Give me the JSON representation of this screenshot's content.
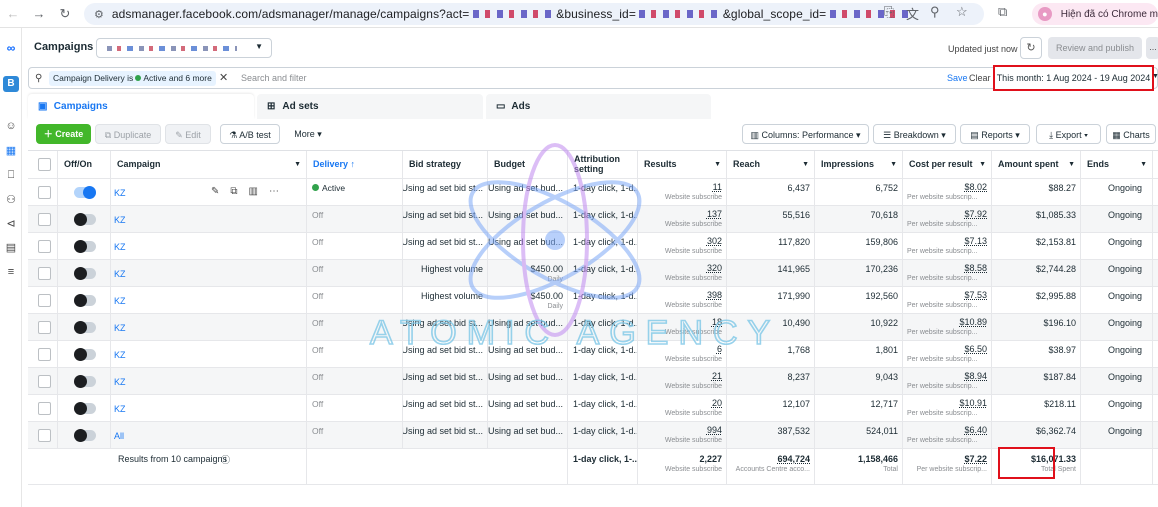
{
  "browser": {
    "url_host": "adsmanager.facebook.com",
    "url_path": "/adsmanager/manage/campaigns?act=",
    "url_param_business": "&business_id=",
    "url_param_scope": "&global_scope_id=",
    "profile_label": "Hiện đã có Chrome m"
  },
  "rail": {
    "badge_letter": "B",
    "help_label": "?"
  },
  "header": {
    "title": "Campaigns",
    "updated_text": "Updated just now",
    "review_label": "Review and publish",
    "more_label": "..."
  },
  "filter": {
    "chip_prefix": "Campaign Delivery is",
    "chip_active": "Active",
    "chip_more": "and 6 more",
    "placeholder": "Search and filter",
    "save_label": "Save",
    "clear_label": "Clear",
    "date_range": "This month: 1 Aug 2024 - 19 Aug 2024"
  },
  "tabs": [
    {
      "label": "Campaigns"
    },
    {
      "label": "Ad sets"
    },
    {
      "label": "Ads"
    }
  ],
  "toolbar": {
    "create": "Create",
    "duplicate": "Duplicate",
    "edit": "Edit",
    "ab_test": "A/B test",
    "more": "More",
    "columns": "Columns: Performance",
    "breakdown": "Breakdown",
    "reports": "Reports",
    "export": "Export",
    "charts": "Charts"
  },
  "columns": {
    "offon": "Off/On",
    "campaign": "Campaign",
    "delivery": "Delivery ↑",
    "bid": "Bid strategy",
    "budget": "Budget",
    "attr1": "Attribution",
    "attr2": "setting",
    "results": "Results",
    "reach": "Reach",
    "impressions": "Impressions",
    "cpr": "Cost per result",
    "spent": "Amount spent",
    "ends": "Ends"
  },
  "rows": [
    {
      "name": "KZ",
      "on": true,
      "delivery": "Active",
      "bid": "Using ad set bid st...",
      "budget": "Using ad set bud...",
      "budget_sub": "",
      "attr": "1-day click, 1-d...",
      "results": "11",
      "results_sub": "Website subscribe",
      "reach": "6,437",
      "impressions": "6,752",
      "cpr": "$8.02",
      "cpr_sub": "Per website subscrip...",
      "spent": "$88.27",
      "ends": "Ongoing"
    },
    {
      "name": "KZ",
      "on": false,
      "delivery": "Off",
      "bid": "Using ad set bid st...",
      "budget": "Using ad set bud...",
      "budget_sub": "",
      "attr": "1-day click, 1-d...",
      "results": "137",
      "results_sub": "Website subscribe",
      "reach": "55,516",
      "impressions": "70,618",
      "cpr": "$7.92",
      "cpr_sub": "Per website subscrip...",
      "spent": "$1,085.33",
      "ends": "Ongoing"
    },
    {
      "name": "KZ",
      "on": false,
      "delivery": "Off",
      "bid": "Using ad set bid st...",
      "budget": "Using ad set bud...",
      "budget_sub": "",
      "attr": "1-day click, 1-d...",
      "results": "302",
      "results_sub": "Website subscribe",
      "reach": "117,820",
      "impressions": "159,806",
      "cpr": "$7.13",
      "cpr_sub": "Per website subscrip...",
      "spent": "$2,153.81",
      "ends": "Ongoing"
    },
    {
      "name": "KZ",
      "on": false,
      "delivery": "Off",
      "bid": "Highest volume",
      "budget": "$450.00",
      "budget_sub": "Daily",
      "attr": "1-day click, 1-d...",
      "results": "320",
      "results_sub": "Website subscribe",
      "reach": "141,965",
      "impressions": "170,236",
      "cpr": "$8.58",
      "cpr_sub": "Per website subscrip...",
      "spent": "$2,744.28",
      "ends": "Ongoing"
    },
    {
      "name": "KZ",
      "on": false,
      "delivery": "Off",
      "bid": "Highest volume",
      "budget": "$450.00",
      "budget_sub": "Daily",
      "attr": "1-day click, 1-d...",
      "results": "398",
      "results_sub": "Website subscribe",
      "reach": "171,990",
      "impressions": "192,560",
      "cpr": "$7.53",
      "cpr_sub": "Per website subscrip...",
      "spent": "$2,995.88",
      "ends": "Ongoing"
    },
    {
      "name": "KZ",
      "on": false,
      "delivery": "Off",
      "bid": "Using ad set bid st...",
      "budget": "Using ad set bud...",
      "budget_sub": "",
      "attr": "1-day click, 1-d...",
      "results": "18",
      "results_sub": "Website subscribe",
      "reach": "10,490",
      "impressions": "10,922",
      "cpr": "$10.89",
      "cpr_sub": "Per website subscrip...",
      "spent": "$196.10",
      "ends": "Ongoing"
    },
    {
      "name": "KZ",
      "on": false,
      "delivery": "Off",
      "bid": "Using ad set bid st...",
      "budget": "Using ad set bud...",
      "budget_sub": "",
      "attr": "1-day click, 1-d...",
      "results": "6",
      "results_sub": "Website subscribe",
      "reach": "1,768",
      "impressions": "1,801",
      "cpr": "$6.50",
      "cpr_sub": "Per website subscrip...",
      "spent": "$38.97",
      "ends": "Ongoing"
    },
    {
      "name": "KZ",
      "on": false,
      "delivery": "Off",
      "bid": "Using ad set bid st...",
      "budget": "Using ad set bud...",
      "budget_sub": "",
      "attr": "1-day click, 1-d...",
      "results": "21",
      "results_sub": "Website subscribe",
      "reach": "8,237",
      "impressions": "9,043",
      "cpr": "$8.94",
      "cpr_sub": "Per website subscrip...",
      "spent": "$187.84",
      "ends": "Ongoing"
    },
    {
      "name": "KZ",
      "on": false,
      "delivery": "Off",
      "bid": "Using ad set bid st...",
      "budget": "Using ad set bud...",
      "budget_sub": "",
      "attr": "1-day click, 1-d...",
      "results": "20",
      "results_sub": "Website subscribe",
      "reach": "12,107",
      "impressions": "12,717",
      "cpr": "$10.91",
      "cpr_sub": "Per website subscrip...",
      "spent": "$218.11",
      "ends": "Ongoing"
    },
    {
      "name": "All",
      "on": false,
      "delivery": "Off",
      "bid": "Using ad set bid st...",
      "budget": "Using ad set bud...",
      "budget_sub": "",
      "attr": "1-day click, 1-d...",
      "results": "994",
      "results_sub": "Website subscribe",
      "reach": "387,532",
      "impressions": "524,011",
      "cpr": "$6.40",
      "cpr_sub": "Per website subscrip...",
      "spent": "$6,362.74",
      "ends": "Ongoing"
    }
  ],
  "totals": {
    "label": "Results from 10 campaigns",
    "attr": "1-day click, 1-...",
    "results": "2,227",
    "results_sub": "Website subscribe",
    "reach": "694,724",
    "reach_sub": "Accounts Centre acco...",
    "impressions": "1,158,466",
    "impressions_sub": "Total",
    "cpr": "$7.22",
    "cpr_sub": "Per website subscrip...",
    "spent": "$16,071.33",
    "spent_sub": "Total Spent"
  },
  "watermark": "ATOMIC AGENCY",
  "colors": {
    "accent": "#1877f2",
    "create": "#42b72a",
    "highlight": "#e0101b",
    "active_dot": "#31a24c"
  }
}
